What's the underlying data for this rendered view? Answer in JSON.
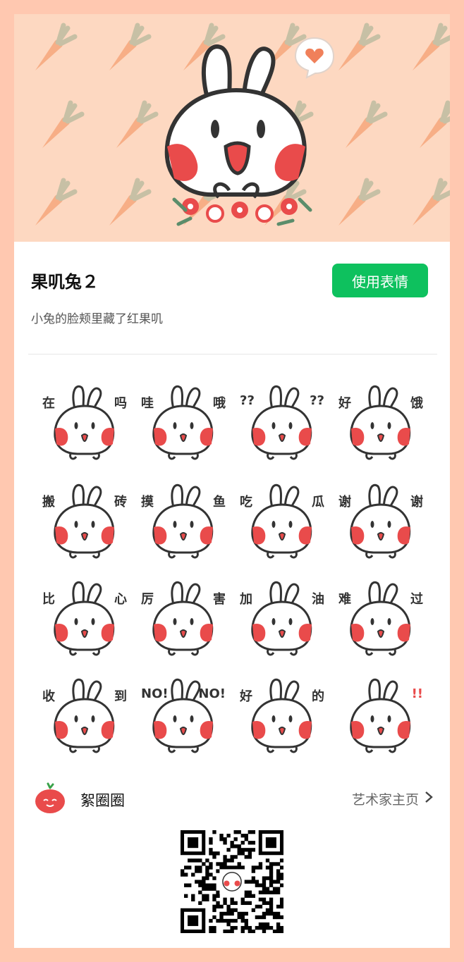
{
  "pack": {
    "title": "果叽兔２",
    "description": "小兔的脸颊里藏了红果叽",
    "use_button": "使用表情"
  },
  "stickers": [
    {
      "left": "在",
      "right": "吗"
    },
    {
      "left": "哇",
      "right": "哦"
    },
    {
      "left": "??",
      "right": "??"
    },
    {
      "left": "好",
      "right": "饿"
    },
    {
      "left": "搬",
      "right": "砖"
    },
    {
      "left": "摸",
      "right": "鱼"
    },
    {
      "left": "吃",
      "right": "瓜"
    },
    {
      "left": "谢",
      "right": "谢"
    },
    {
      "left": "比",
      "right": "心"
    },
    {
      "left": "厉",
      "right": "害"
    },
    {
      "left": "加",
      "right": "油"
    },
    {
      "left": "难",
      "right": "过"
    },
    {
      "left": "收",
      "right": "到"
    },
    {
      "left": "NO!",
      "right": "NO!"
    },
    {
      "left": "好",
      "right": "的"
    },
    {
      "left": "",
      "right": "!!"
    }
  ],
  "author": {
    "name": "絮圈圈",
    "link_label": "艺术家主页",
    "avatar_icon": "tomato-avatar-icon"
  },
  "qr": {
    "icon": "qr-code-icon"
  },
  "colors": {
    "page_bg": "#ffc8b0",
    "banner_bg": "#fdd8c1",
    "accent_green": "#0ec15e",
    "cheek_red": "#e94b4b"
  }
}
